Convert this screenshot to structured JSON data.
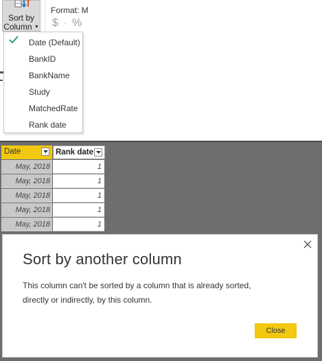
{
  "ribbon": {
    "sort_by_column": {
      "line1": "Sort by",
      "line2": "Column"
    },
    "format": {
      "label": "Format: M",
      "dollar": "$",
      "dropdown": "-",
      "percent": "%"
    }
  },
  "sort_menu": {
    "items": [
      {
        "label": "Date (Default)",
        "checked": true
      },
      {
        "label": "BankID"
      },
      {
        "label": "BankName"
      },
      {
        "label": "Study"
      },
      {
        "label": "MatchedRate"
      },
      {
        "label": "Rank date"
      }
    ],
    "check_color": "#3a9a6a"
  },
  "table": {
    "headers": [
      "Date",
      "Rank date"
    ],
    "rows": [
      [
        "May, 2018",
        "1"
      ],
      [
        "May, 2018",
        "1"
      ],
      [
        "May, 2018",
        "1"
      ],
      [
        "May, 2018",
        "1"
      ],
      [
        "May, 2018",
        "1"
      ]
    ]
  },
  "dialog": {
    "title": "Sort by another column",
    "message_line1": "This column can't be sorted by a column that is already sorted,",
    "message_line2": "directly or indirectly, by this column.",
    "close_label": "Close"
  },
  "colors": {
    "accent_yellow": "#f2c811",
    "workspace_gray": "#6e6e6e",
    "date_cell_gray": "#c8c8c8"
  }
}
